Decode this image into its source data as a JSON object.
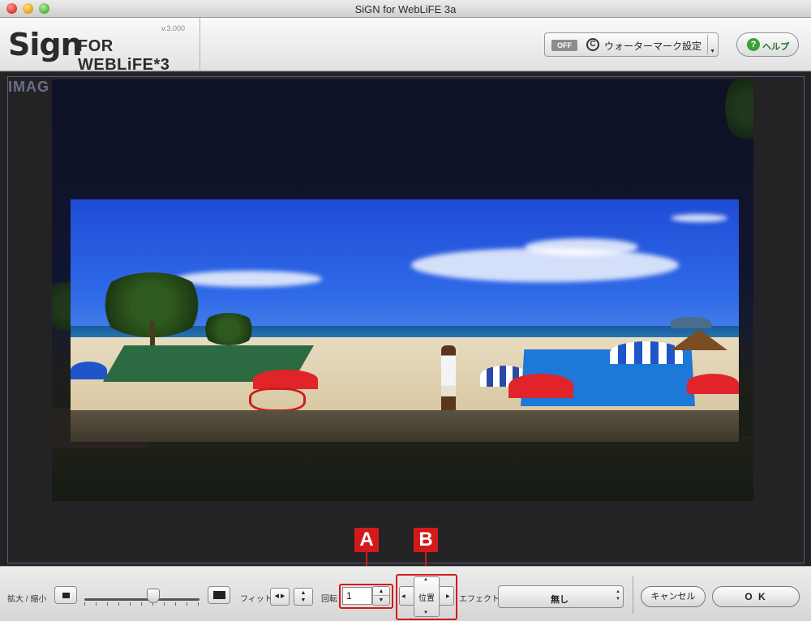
{
  "window": {
    "title": "SiGN for WebLiFE 3a"
  },
  "header": {
    "logo_sign": "Sign",
    "logo_rest": "FOR WEBLiFE*3",
    "version": "v.3.000",
    "watermark": {
      "toggle": "OFF",
      "copyright_symbol": "C",
      "label": "ウォーターマーク設定"
    },
    "help": {
      "icon_glyph": "?",
      "label": "ヘルプ"
    }
  },
  "canvas": {
    "section_label": "IMAG"
  },
  "markers": {
    "a": "A",
    "b": "B"
  },
  "toolbar": {
    "zoom_label": "拡大 / 縮小",
    "zoom_level": 0.6,
    "fit_label": "フィット",
    "rotate_label": "回転",
    "rotate_value": "1",
    "position_label": "位置",
    "effect_label": "エフェクト",
    "effect_value": "無し",
    "cancel_label": "キャンセル",
    "ok_label": "O K"
  },
  "colors": {
    "marker": "#d21a1a",
    "help_green": "#3aa03a",
    "canvas_bg": "#232326",
    "sky": "#2f6ae8"
  }
}
